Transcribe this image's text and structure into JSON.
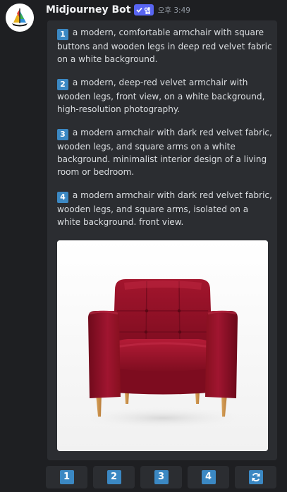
{
  "message": {
    "username": "Midjourney Bot",
    "app_tag": "앱",
    "timestamp": "오후 3:49",
    "prompts": [
      {
        "number": "1",
        "text": "a modern, comfortable armchair with square buttons and wooden legs in deep red velvet fabric on a white background."
      },
      {
        "number": "2",
        "text": "a modern, deep-red velvet armchair with wooden legs, front view, on a white background, high-resolution photography."
      },
      {
        "number": "3",
        "text": "a modern armchair with dark red velvet fabric, wooden legs, and square arms on a white background. minimalist interior design of a living room or bedroom."
      },
      {
        "number": "4",
        "text": "a modern armchair with dark red velvet fabric, wooden legs, and square arms, isolated on a white background. front view."
      }
    ]
  },
  "buttons": [
    {
      "label": "1"
    },
    {
      "label": "2"
    },
    {
      "label": "3"
    },
    {
      "label": "4"
    },
    {
      "icon": "refresh-icon"
    }
  ],
  "colors": {
    "background": "#1e1f22",
    "embed": "#2b2d31",
    "app_tag": "#5865f2",
    "number_badge": "#3b88c3",
    "velvet": "#8e0f24"
  }
}
